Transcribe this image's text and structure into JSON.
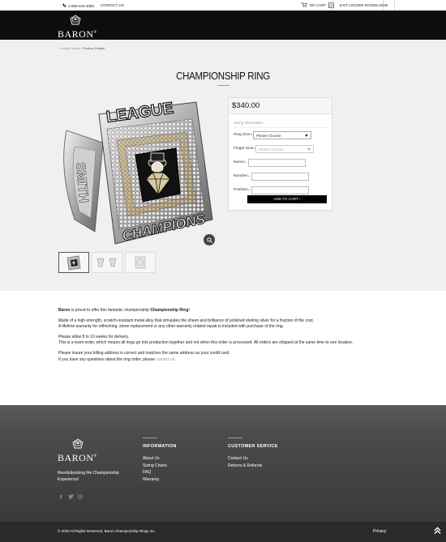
{
  "topbar": {
    "phone": "1-866-944-4083",
    "contact": "CONTACT US",
    "my_cart": "MY CART",
    "cart_count": "0",
    "exit": "EXIT LOCKER ROOM",
    "login": "LOGIN"
  },
  "brand": {
    "name": "BARON",
    "reg": "®",
    "accent_color": "#b59a6b"
  },
  "breadcrumb": {
    "home": "Locker Room",
    "sep": "›",
    "current": "Product Details"
  },
  "product": {
    "title": "CHAMPIONSHIP RING",
    "price": "$340.00",
    "section": "Sizing Information",
    "ring_size_label": "Ring Size:",
    "ring_size_value": "Please Choose",
    "finger_size_label": "Finger Size:",
    "finger_size_value": "Please Choose",
    "name_label": "Name:",
    "number_label": "Number:",
    "position_label": "Position:",
    "required_mark": "*",
    "add_to_cart": "ADD TO CART ›",
    "ring_top_text": "LEAGUE",
    "ring_bottom_text": "CHAMPIONS",
    "ring_side_text": "SMITH"
  },
  "description": {
    "intro_brand": "Baron",
    "intro_mid": " is proud to offer this fantastic championship ",
    "intro_bold": "Championship Ring",
    "intro_end": "!",
    "p2_line1": "Made of a high-strength, scratch-resistant metal alloy that simulates the sheen and brilliance of polished sterling silver for a fraction of the cost.",
    "p2_line2": "A lifetime warranty for refinishing, stone replacement or any other warranty related repair is included with purchase of the ring.",
    "p3_line1": "Please allow 8 to 10 weeks for delivery.",
    "p3_line2": "This is a team order, which means all rings go into production together and not when this order is processed. All orders are shipped at the same time to one location.",
    "p4_line1": "Please insure your billing address is correct and matches the same address as your credit card.",
    "p4_line2": "If you have any questions about the ring order, please ",
    "p4_link": "contact us",
    "p4_end": "."
  },
  "footer": {
    "tagline": "Revolutionizing the Championship Experience!",
    "info_heading": "INFORMATION",
    "info_links": [
      "About Us",
      "Sizing Charts",
      "FAQ",
      "Warranty"
    ],
    "cs_heading": "CUSTOMER SERVICE",
    "cs_links": [
      "Contact Us",
      "Returns & Refunds"
    ],
    "copyright": "© 2020 All Rights Reserved, Baron Championship Rings Inc.",
    "privacy": "Privacy"
  }
}
